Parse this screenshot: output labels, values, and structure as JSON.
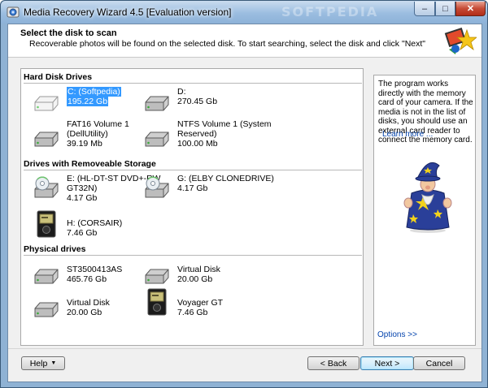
{
  "window": {
    "title": "Media Recovery Wizard 4.5 [Evaluation version]",
    "watermark": "SOFTPEDIA",
    "controls": {
      "minimize": "–",
      "maximize": "□",
      "close": "✕"
    }
  },
  "header": {
    "title": "Select the disk to scan",
    "subtitle": "Recoverable photos will be found on the selected disk. To start searching, select the disk and click \"Next\""
  },
  "groups": {
    "hard_disk": {
      "title": "Hard Disk Drives",
      "drives": [
        {
          "name": "C: (Softpedia)",
          "size": "195.22 Gb",
          "icon": "hard-drive-icon",
          "selected": true
        },
        {
          "name": "D:",
          "size": "270.45 Gb",
          "icon": "hard-drive-icon"
        },
        {
          "name": "FAT16 Volume 1\n(DellUtility)",
          "size": "39.19 Mb",
          "icon": "hard-drive-icon"
        },
        {
          "name": "NTFS Volume 1 (System\nReserved)",
          "size": "100.00 Mb",
          "icon": "hard-drive-icon"
        }
      ]
    },
    "removable": {
      "title": "Drives with Removeable Storage",
      "drives": [
        {
          "name": "E: (HL-DT-ST DVD+-RW\nGT32N)",
          "size": "4.17 Gb",
          "icon": "optical-drive-icon"
        },
        {
          "name": "G: (ELBY CLONEDRIVE)",
          "size": "4.17 Gb",
          "icon": "optical-drive-icon"
        },
        {
          "name": "H: (CORSAIR)",
          "size": "7.46 Gb",
          "icon": "media-player-icon"
        }
      ]
    },
    "physical": {
      "title": "Physical drives",
      "drives": [
        {
          "name": "ST3500413AS",
          "size": "465.76 Gb",
          "icon": "hard-drive-icon"
        },
        {
          "name": "Virtual Disk",
          "size": "20.00 Gb",
          "icon": "hard-drive-icon"
        },
        {
          "name": "Virtual Disk",
          "size": "20.00 Gb",
          "icon": "hard-drive-icon"
        },
        {
          "name": "Voyager GT",
          "size": "7.46 Gb",
          "icon": "media-player-icon"
        }
      ]
    }
  },
  "info": {
    "text": "The program works directly with the memory card of your camera. If the media is not in the list of disks, you should use an external card reader to connect the memory card.",
    "learn_more": "Learn more ...",
    "options": "Options >>"
  },
  "buttons": {
    "help": "Help",
    "back": "< Back",
    "next": "Next >",
    "cancel": "Cancel"
  },
  "colors": {
    "selection": "#3399ff",
    "link": "#0645ad",
    "title_bar": "#9bbde0"
  }
}
